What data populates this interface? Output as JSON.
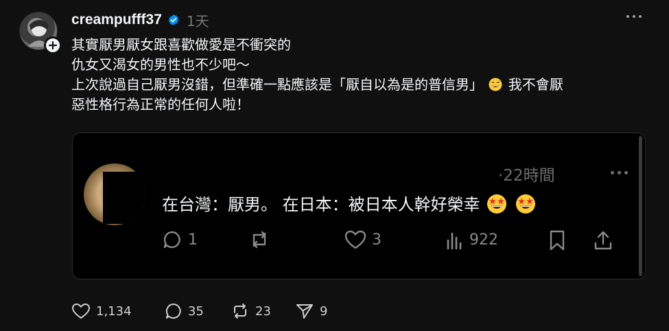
{
  "post": {
    "username": "creampufff37",
    "timestamp": "1天",
    "body_lines": [
      "其實厭男厭女跟喜歡做愛是不衝突的",
      "仇女又渴女的男性也不少吧～",
      "上次說過自己厭男沒錯，但準確一點應該是「厭自以為是的普信男」",
      "我不會厭",
      "惡性格行為正常的任何人啦！"
    ],
    "icons": {
      "verified": "verified-badge-icon",
      "emoji_line3": "grinning-sweat-emoji-icon",
      "more": "more-horizontal-icon",
      "follow": "plus-icon"
    },
    "accent_color": "#0095f6"
  },
  "embedded": {
    "time": "·22時間",
    "text": "在台灣：厭男。 在日本：被日本人幹好榮幸",
    "emoji": "star-struck-emoji-icon",
    "replies": "1",
    "likes": "3",
    "views": "922",
    "icons": [
      "comment-icon",
      "repost-icon",
      "heart-icon",
      "views-bar-icon",
      "bookmark-icon",
      "share-icon"
    ]
  },
  "actions": {
    "likes": "1,134",
    "comments": "35",
    "reposts": "23",
    "shares": "9",
    "icons": [
      "heart-icon",
      "comment-icon",
      "repost-icon",
      "send-icon"
    ]
  }
}
